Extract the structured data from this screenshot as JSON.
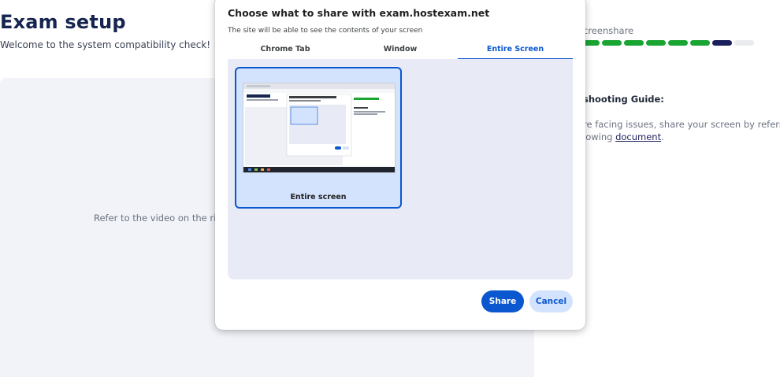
{
  "page": {
    "title": "Exam setup",
    "subtitle": "Welcome to the system compatibility check!",
    "video_hint": "Refer to the video on the righ",
    "step_label": "creenshare",
    "progress": {
      "completed": 6,
      "current": 7,
      "total": 8
    },
    "guide": {
      "title": "shooting Guide:",
      "line1": "re facing issues, share your screen by referring",
      "line2_prefix": "lowing ",
      "link": "document",
      "line2_suffix": "."
    }
  },
  "dialog": {
    "title": "Choose what to share with exam.hostexam.net",
    "subtitle": "The site will be able to see the contents of your screen",
    "tabs": [
      "Chrome Tab",
      "Window",
      "Entire Screen"
    ],
    "active_tab": "Entire Screen",
    "screen_option_label": "Entire screen",
    "share_label": "Share",
    "cancel_label": "Cancel"
  },
  "colors": {
    "accent": "#0b57d0",
    "accent_light": "#d3e3fd",
    "progress_done": "#1aa532",
    "progress_current": "#1b1f5c",
    "progress_todo": "#e9ebef",
    "title": "#16254f"
  }
}
